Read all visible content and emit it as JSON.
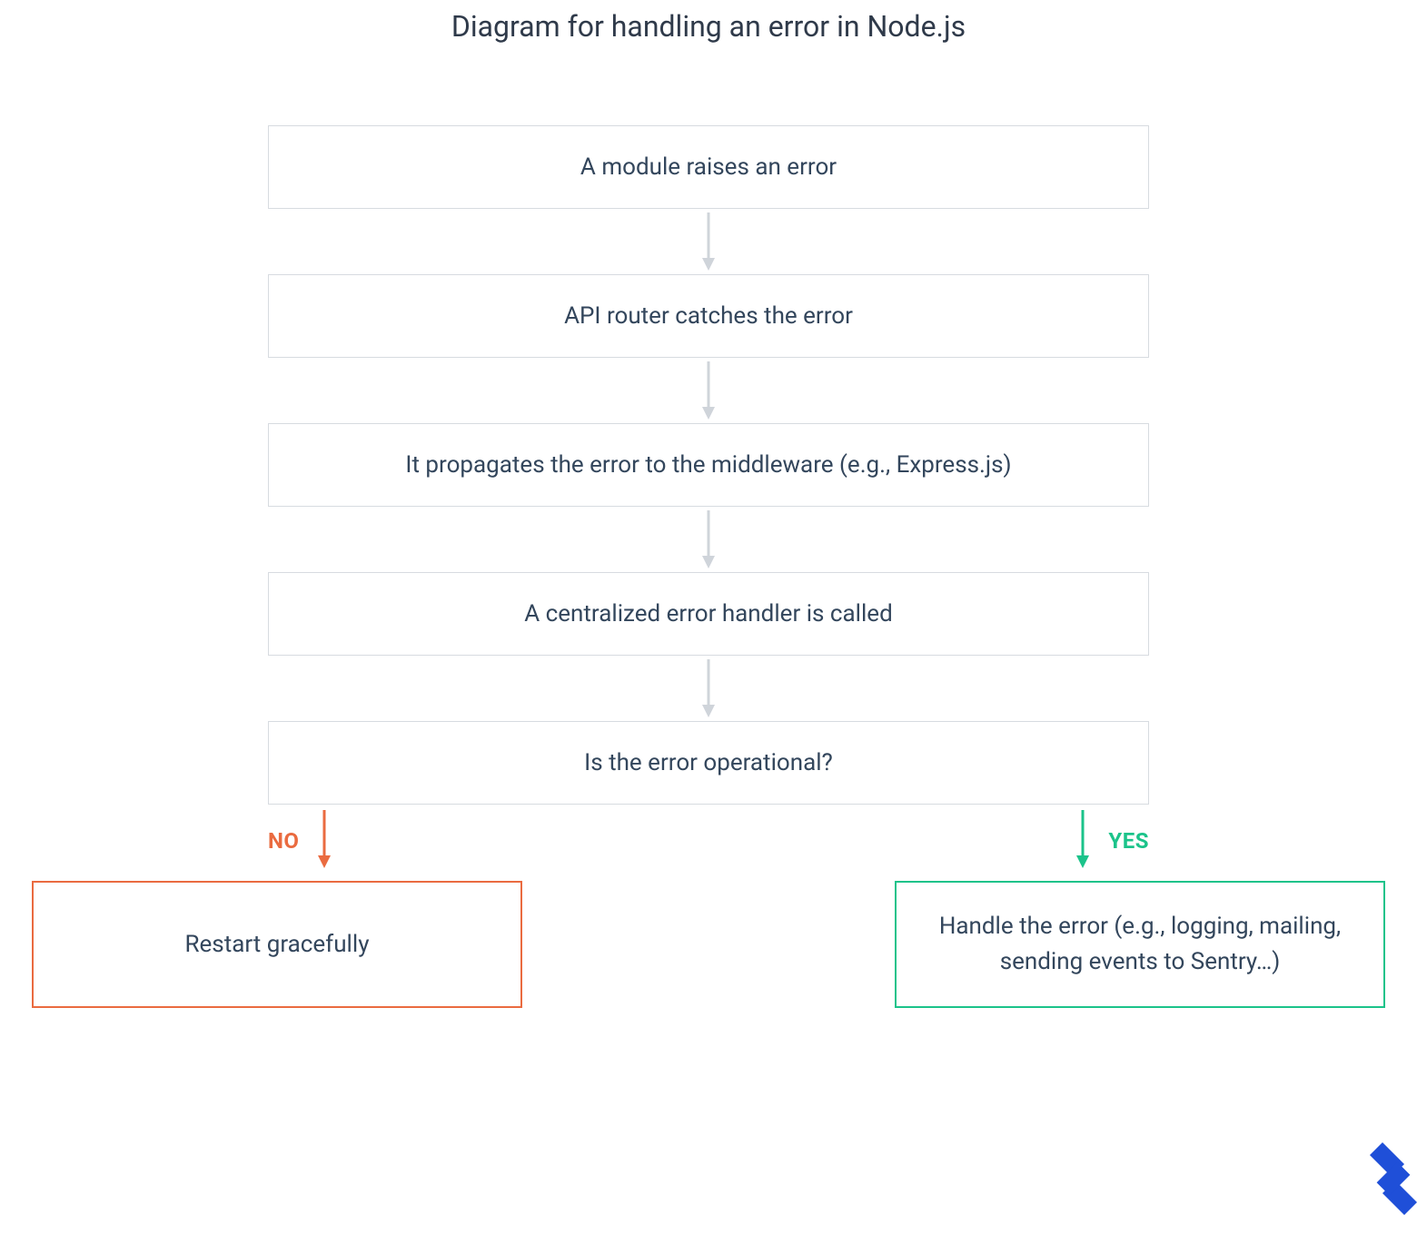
{
  "title": "Diagram for handling an error in Node.js",
  "steps": {
    "s1": "A module raises an error",
    "s2": "API router catches the error",
    "s3": "It propagates the error to the middleware (e.g., Express.js)",
    "s4": "A centralized error handler is called",
    "s5": "Is the error operational?"
  },
  "branches": {
    "no": {
      "label": "NO",
      "result": "Restart gracefully"
    },
    "yes": {
      "label": "YES",
      "result": "Handle the error (e.g., logging, mailing, sending events to Sentry…)"
    }
  },
  "colors": {
    "box_border": "#d7dbe0",
    "text": "#33465c",
    "arrow_grey": "#cfd4da",
    "no": "#ea6b40",
    "yes": "#1bc38a",
    "logo": "#1f4fd8"
  }
}
